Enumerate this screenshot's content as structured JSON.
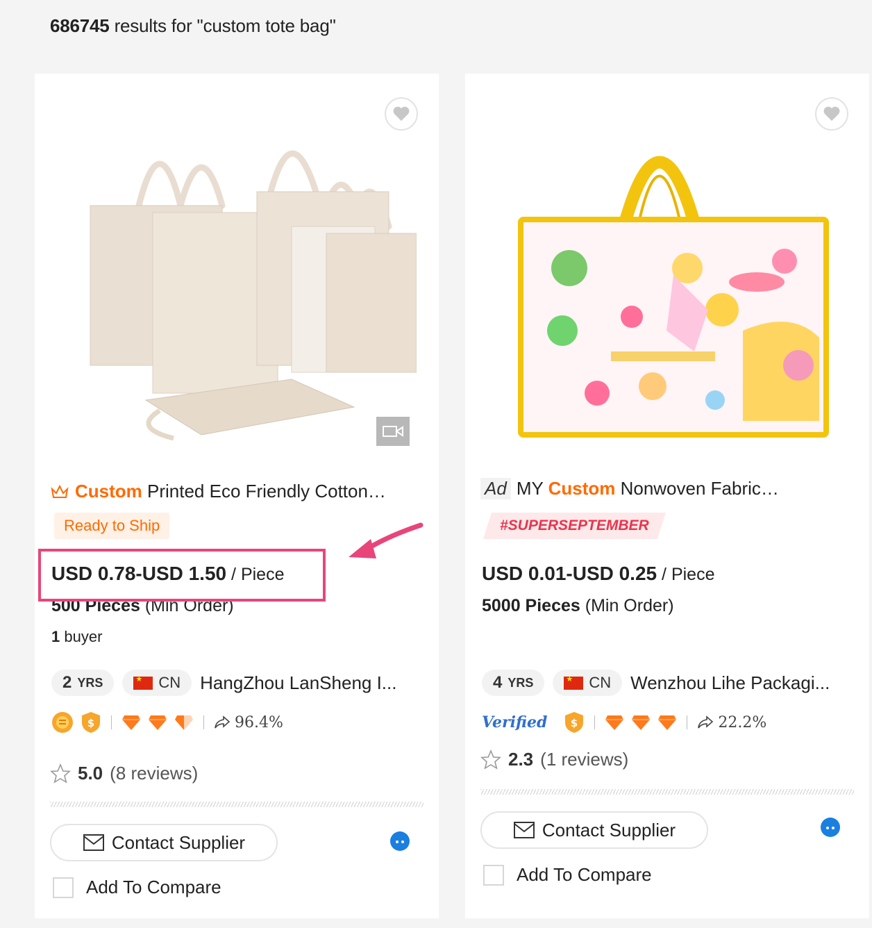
{
  "results": {
    "count": "686745",
    "text": " results for \"custom tote bag\""
  },
  "products": [
    {
      "title_prefix": "",
      "title_keyword": "Custom",
      "title_rest": " Printed Eco Friendly Cotton…",
      "badge": "Ready to Ship",
      "price_range": "USD 0.78-USD 1.50",
      "price_unit": " / Piece",
      "moq_value": "500 Pieces",
      "moq_label": " (Min Order)",
      "buyers_count": "1",
      "buyers_label": " buyer",
      "years": "2",
      "years_unit": "YRS",
      "country": "CN",
      "company": "HangZhou LanSheng I...",
      "response_rate": "96.4%",
      "rating": "5.0",
      "reviews": "(8 reviews)",
      "contact_label": "Contact Supplier",
      "compare_label": "Add To Compare"
    },
    {
      "title_prefix": "Ad",
      "title_keyword": "Custom",
      "title_prefix2": "MY ",
      "title_rest": " Nonwoven Fabric…",
      "badge": "#SUPERSEPTEMBER",
      "price_range": "USD 0.01-USD 0.25",
      "price_unit": " / Piece",
      "moq_value": "5000 Pieces",
      "moq_label": " (Min Order)",
      "years": "4",
      "years_unit": "YRS",
      "country": "CN",
      "company": "Wenzhou Lihe Packagi...",
      "verified_label": "Verified",
      "response_rate": "22.2%",
      "rating": "2.3",
      "reviews": "(1 reviews)",
      "contact_label": "Contact Supplier",
      "compare_label": "Add To Compare"
    }
  ],
  "colors": {
    "accent": "#ff6a00",
    "highlight": "#e8457a",
    "verified": "#2f6fcf"
  }
}
